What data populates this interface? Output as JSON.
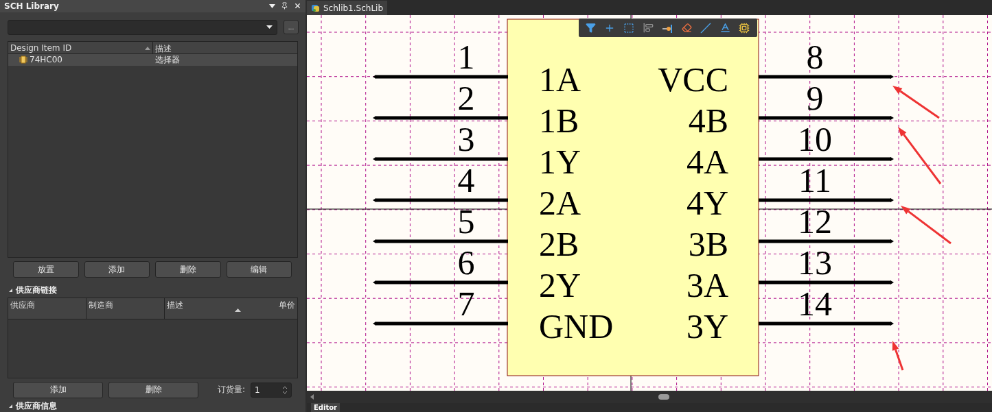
{
  "panel": {
    "title": "SCH Library",
    "browse_button": "...",
    "library_table": {
      "columns": [
        "Design Item ID",
        "描述"
      ],
      "rows": [
        {
          "id": "74HC00",
          "description": "选择器",
          "selected": true
        }
      ]
    },
    "buttons": [
      "放置",
      "添加",
      "删除",
      "编辑"
    ],
    "supplier_section": {
      "title": "供应商链接",
      "expanded": true,
      "columns": [
        "供应商",
        "制造商",
        "描述",
        "单价"
      ],
      "buttons": [
        "添加",
        "删除"
      ],
      "quantity_label": "订货量:",
      "quantity_value": "1"
    },
    "next_section": {
      "title": "供应商信息",
      "expanded": true
    }
  },
  "document_tab": {
    "label": "Schlib1.SchLib",
    "selected": true
  },
  "schematic": {
    "left_pins": [
      {
        "number": "1",
        "name": "1A"
      },
      {
        "number": "2",
        "name": "1B"
      },
      {
        "number": "3",
        "name": "1Y"
      },
      {
        "number": "4",
        "name": "2A"
      },
      {
        "number": "5",
        "name": "2B"
      },
      {
        "number": "6",
        "name": "2Y"
      },
      {
        "number": "7",
        "name": "GND"
      }
    ],
    "right_pins": [
      {
        "number": "8",
        "name": "VCC"
      },
      {
        "number": "9",
        "name": "4B"
      },
      {
        "number": "10",
        "name": "4A"
      },
      {
        "number": "11",
        "name": "4Y"
      },
      {
        "number": "12",
        "name": "3B"
      },
      {
        "number": "13",
        "name": "3A"
      },
      {
        "number": "14",
        "name": "3Y"
      }
    ]
  },
  "bottom_tab": {
    "label": "Editor",
    "selected": true
  }
}
